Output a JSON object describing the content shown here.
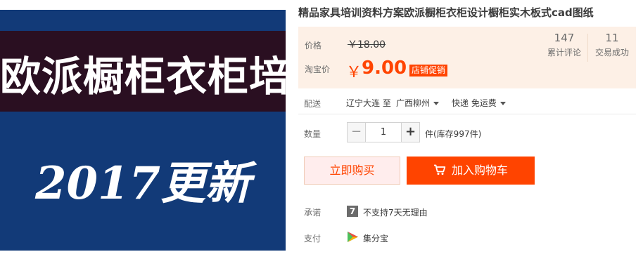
{
  "image": {
    "line1": "欧派橱柜衣柜培训",
    "line2": "2017更新"
  },
  "product": {
    "title": "精品家具培训资料方案欧派橱柜衣柜设计橱柜实木板式cad图纸"
  },
  "price": {
    "label": "价格",
    "original": "￥18.00",
    "taobao_label": "淘宝价",
    "currency_symbol": "￥",
    "current": "9.00",
    "promo_badge": "店铺促销",
    "accent_color": "#ff4400"
  },
  "stats": {
    "reviews_count": "147",
    "reviews_label": "累计评论",
    "trades_count": "11",
    "trades_label": "交易成功"
  },
  "shipping": {
    "label": "配送",
    "from": "辽宁大连 至",
    "to": "广西柳州",
    "method": "快递 免运费"
  },
  "quantity": {
    "label": "数量",
    "minus": "−",
    "value": "1",
    "plus": "+",
    "stock": "件(库存997件)"
  },
  "actions": {
    "buy_now": "立即购买",
    "add_to_cart": "加入购物车"
  },
  "promise": {
    "label": "承诺",
    "icon_glyph": "7",
    "text": "不支持7天无理由"
  },
  "payment": {
    "label": "支付",
    "text": "集分宝"
  }
}
